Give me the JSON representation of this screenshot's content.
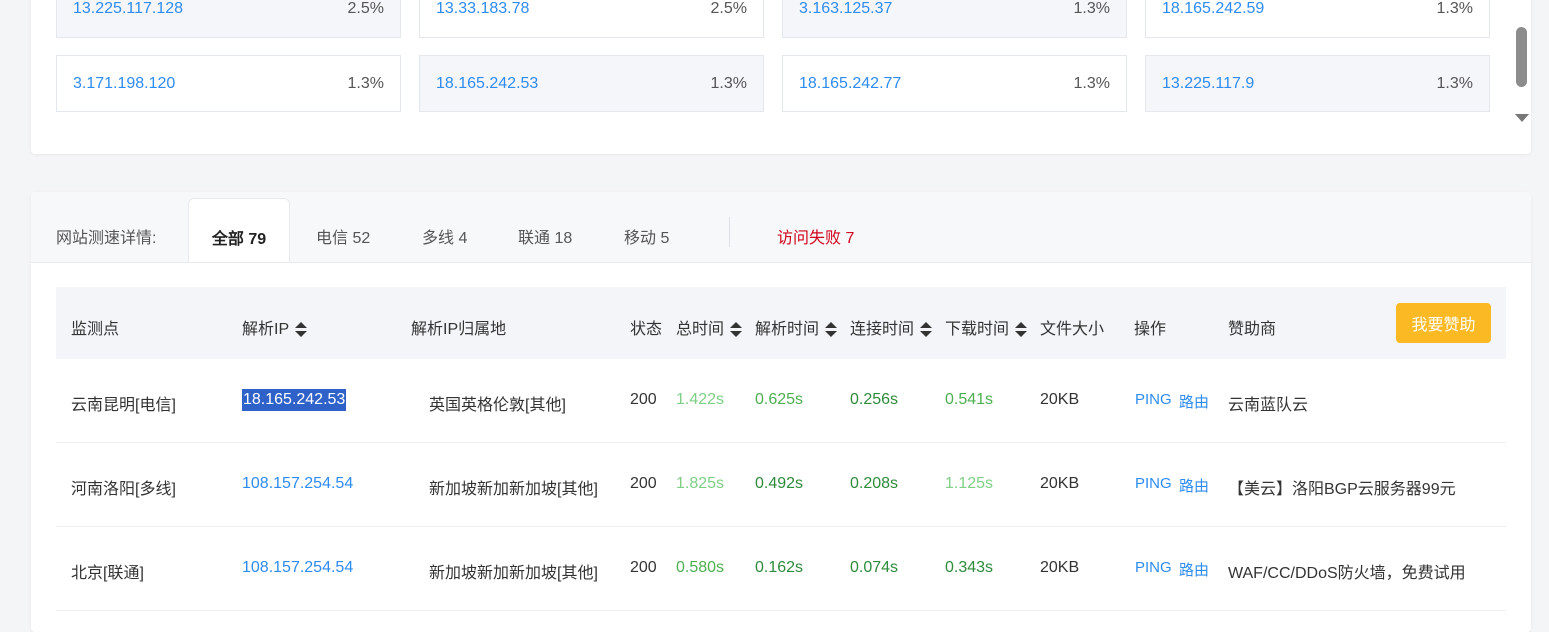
{
  "ip_distribution": [
    {
      "ip": "13.225.117.128",
      "pct": "2.5%"
    },
    {
      "ip": "13.33.183.78",
      "pct": "2.5%"
    },
    {
      "ip": "3.163.125.37",
      "pct": "1.3%"
    },
    {
      "ip": "18.165.242.59",
      "pct": "1.3%"
    },
    {
      "ip": "3.171.198.120",
      "pct": "1.3%"
    },
    {
      "ip": "18.165.242.53",
      "pct": "1.3%"
    },
    {
      "ip": "18.165.242.77",
      "pct": "1.3%"
    },
    {
      "ip": "13.225.117.9",
      "pct": "1.3%"
    }
  ],
  "tabs": {
    "prefix": "网站测速详情:",
    "all": "全部 79",
    "telecom": "电信 52",
    "multiline": "多线 4",
    "unicom": "联通 18",
    "mobile": "移动 5",
    "failed": "访问失败 7"
  },
  "table": {
    "headers": {
      "node": "监测点",
      "ip": "解析IP",
      "location": "解析IP归属地",
      "status": "状态",
      "total": "总时间",
      "resolve": "解析时间",
      "connect": "连接时间",
      "download": "下载时间",
      "size": "文件大小",
      "action": "操作",
      "sponsor": "赞助商"
    },
    "sponsor_button": "我要赞助",
    "rows": [
      {
        "node": "云南昆明[电信]",
        "ip": "18.165.242.53",
        "location": "英国英格伦敦[其他]",
        "status": "200",
        "total": "1.422s",
        "resolve": "0.625s",
        "connect": "0.256s",
        "download": "0.541s",
        "size": "20KB",
        "ping": "PING",
        "route": "路由",
        "sponsor": "云南蓝队云"
      },
      {
        "node": "河南洛阳[多线]",
        "ip": "108.157.254.54",
        "location": "新加坡新加新加坡[其他]",
        "status": "200",
        "total": "1.825s",
        "resolve": "0.492s",
        "connect": "0.208s",
        "download": "1.125s",
        "size": "20KB",
        "ping": "PING",
        "route": "路由",
        "sponsor": "【美云】洛阳BGP云服务器99元"
      },
      {
        "node": "北京[联通]",
        "ip": "108.157.254.54",
        "location": "新加坡新加新加坡[其他]",
        "status": "200",
        "total": "0.580s",
        "resolve": "0.162s",
        "connect": "0.074s",
        "download": "0.343s",
        "size": "20KB",
        "ping": "PING",
        "route": "路由",
        "sponsor": "WAF/CC/DDoS防火墙，免费试用"
      }
    ]
  }
}
